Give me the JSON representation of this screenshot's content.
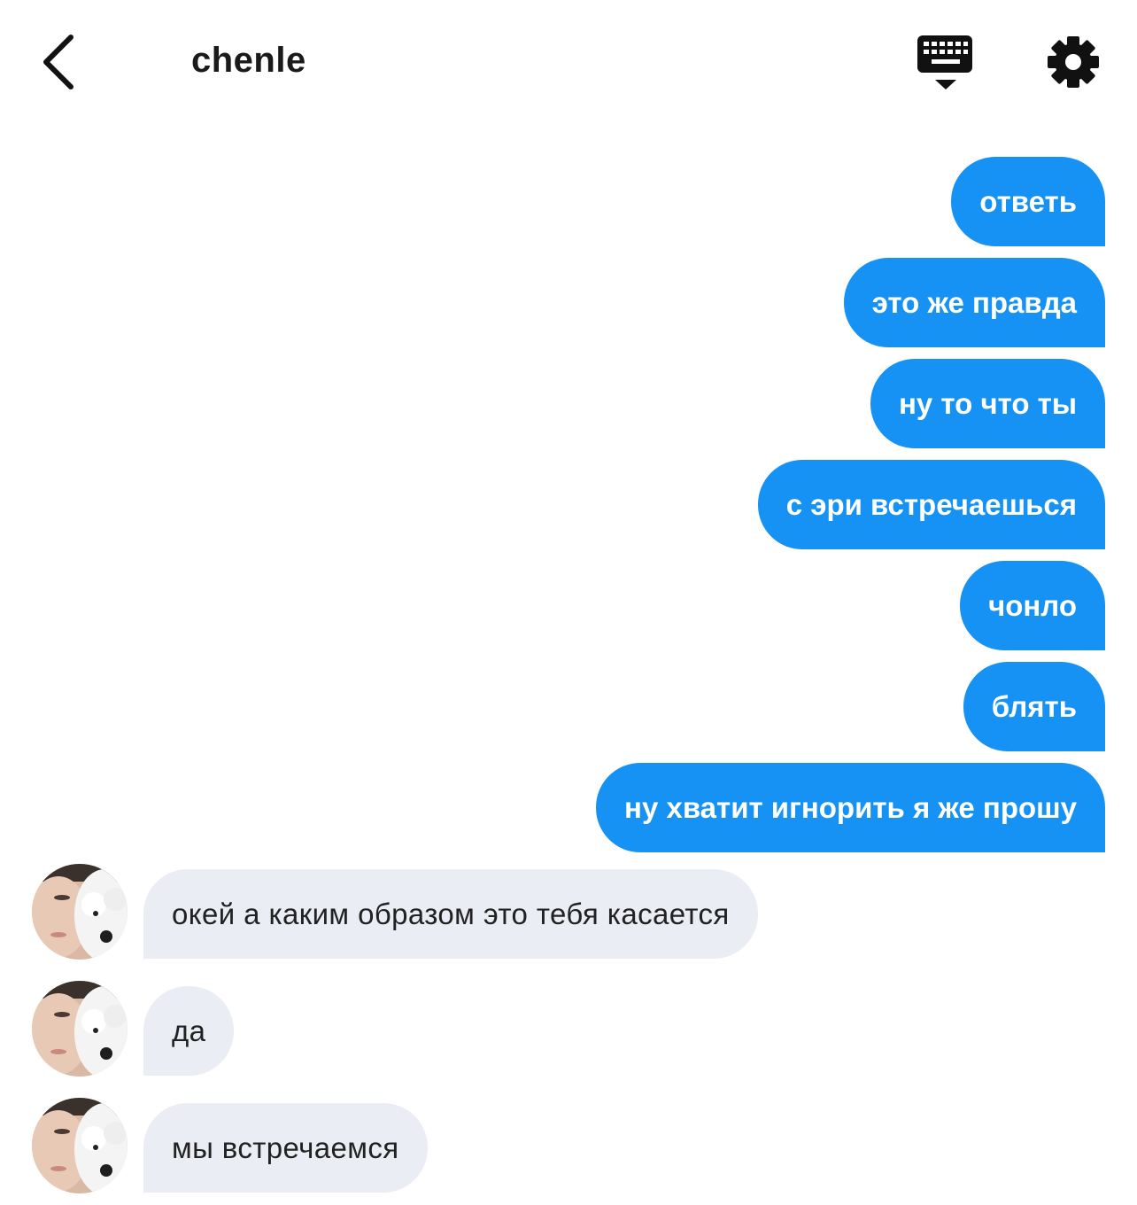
{
  "header": {
    "title": "chenle",
    "back_icon": "chevron-left-icon",
    "keyboard_icon": "keyboard-hide-icon",
    "settings_icon": "gear-icon"
  },
  "colors": {
    "outgoing_bubble": "#1691f4",
    "incoming_bubble": "#eaedf4",
    "text_dark": "#1a1a1a"
  },
  "messages": {
    "outgoing": [
      "ответь",
      "это же правда",
      "ну то что ты",
      "с эри встречаешься",
      "чонло",
      "блять",
      "ну хватит игнорить я же прошу"
    ],
    "incoming": [
      "окей а каким образом это тебя касается",
      "да",
      "мы встречаемся"
    ]
  }
}
